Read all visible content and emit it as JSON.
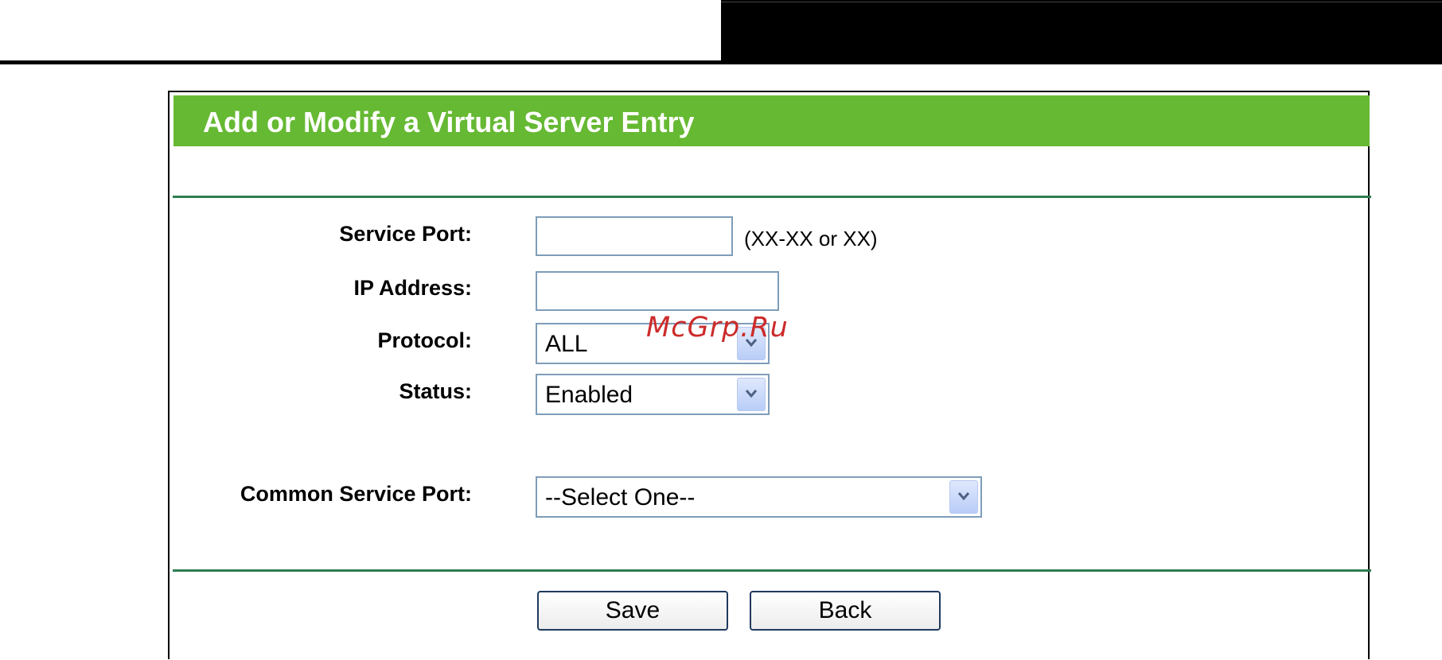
{
  "header": {
    "title": "Add or Modify a Virtual Server Entry"
  },
  "form": {
    "service_port": {
      "label": "Service Port:",
      "value": "",
      "hint": "(XX-XX or XX)"
    },
    "ip_address": {
      "label": "IP Address:",
      "value": ""
    },
    "protocol": {
      "label": "Protocol:",
      "selected": "ALL"
    },
    "status": {
      "label": "Status:",
      "selected": "Enabled"
    },
    "common_service_port": {
      "label": "Common Service Port:",
      "selected": "--Select One--"
    }
  },
  "actions": {
    "save_label": "Save",
    "back_label": "Back"
  },
  "watermark": "McGrp.Ru",
  "colors": {
    "header_green": "#66b933",
    "divider_green": "#2e7d4f",
    "input_border": "#7f9db9",
    "watermark_red": "#cc2b2b"
  }
}
